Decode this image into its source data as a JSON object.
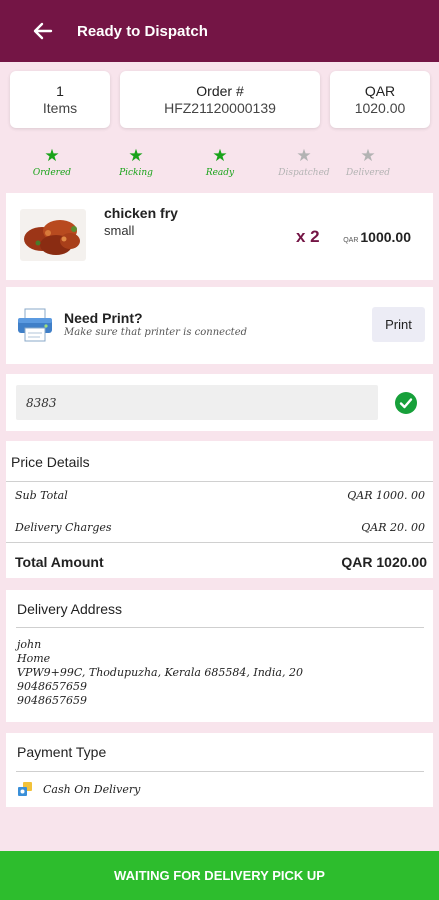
{
  "appbar": {
    "title": "Ready to Dispatch",
    "back_icon": "arrow-left-icon",
    "color": "#741545"
  },
  "summary": {
    "items_count": "1",
    "items_label": "Items",
    "order_label": "Order #",
    "order_number": "HFZ21120000139",
    "currency": "QAR",
    "total": "1020.00"
  },
  "steps": [
    {
      "label": "Ordered",
      "status": "done"
    },
    {
      "label": "Picking",
      "status": "done"
    },
    {
      "label": "Ready",
      "status": "done"
    },
    {
      "label": "Dispatched",
      "status": "pending"
    },
    {
      "label": "Delivered",
      "status": "pending"
    }
  ],
  "item": {
    "name": "chicken fry",
    "variant": "small",
    "qty": "x 2",
    "currency": "QAR",
    "price": "1000.00"
  },
  "print": {
    "title": "Need Print?",
    "subtitle": "Make sure that printer is connected",
    "button": "Print",
    "icon": "printer-icon"
  },
  "code": {
    "value": "8383",
    "icon": "check-circle-icon"
  },
  "price_details": {
    "title": "Price Details",
    "sub_total_label": "Sub Total",
    "sub_total_value": "QAR 1000. 00",
    "delivery_label": "Delivery Charges",
    "delivery_value": "QAR 20. 00",
    "total_label": "Total Amount",
    "total_value": "QAR 1020.00"
  },
  "address": {
    "title": "Delivery Address",
    "name": "john",
    "type": "Home",
    "line": "VPW9+99C, Thodupuzha, Kerala 685584, India, 20",
    "phone1": "9048657659",
    "phone2": "9048657659"
  },
  "payment": {
    "title": "Payment Type",
    "method": "Cash On Delivery",
    "icon": "cash-icon"
  },
  "bottom_button": {
    "label": "WAITING FOR DELIVERY PICK UP",
    "color": "#2dbd2d"
  },
  "colors": {
    "accent": "#741545",
    "success": "#1aa31a",
    "background": "#f8e4ec"
  }
}
